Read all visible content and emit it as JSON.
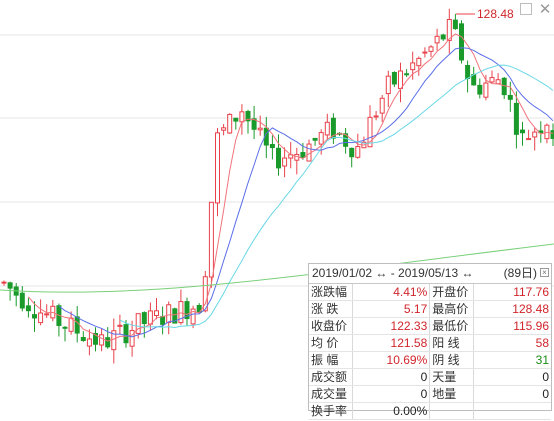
{
  "window": {
    "maximize_icon": "maximize-icon",
    "close_icon": "close-icon"
  },
  "chart": {
    "high_marker": "128.48"
  },
  "colors": {
    "up": "#e8414a",
    "down": "#1a9a2a",
    "ma_red": "#f0737a",
    "ma_blue": "#5a6ee8",
    "ma_cyan": "#6ad8e6",
    "ma_green": "#7ad07a",
    "grid": "#e6e6e6"
  },
  "stats": {
    "date_range": "2019/01/02 ↔ - 2019/05/13 ↔",
    "days": "(89日)",
    "close_icon": "close-icon",
    "rows": [
      {
        "l1": "涨跌幅",
        "v1": "4.41%",
        "l2": "开盘价",
        "v2": "117.76"
      },
      {
        "l1": "涨  跌",
        "v1": "5.17",
        "l2": "最高价",
        "v2": "128.48"
      },
      {
        "l1": "收盘价",
        "v1": "122.33",
        "l2": "最低价",
        "v2": "115.96"
      },
      {
        "l1": "均  价",
        "v1": "121.58",
        "l2": "阳  线",
        "v2": "58"
      },
      {
        "l1": "振  幅",
        "v1": "10.69%",
        "l2": "阴  线",
        "v2": "31"
      },
      {
        "l1": "成交额",
        "v1": "0",
        "l2": "天量",
        "v2": "0"
      },
      {
        "l1": "成交量",
        "v1": "0",
        "l2": "地量",
        "v2": "0"
      },
      {
        "l1": "换手率",
        "v1": "0.00%",
        "l2": "",
        "v2": ""
      }
    ]
  }
}
